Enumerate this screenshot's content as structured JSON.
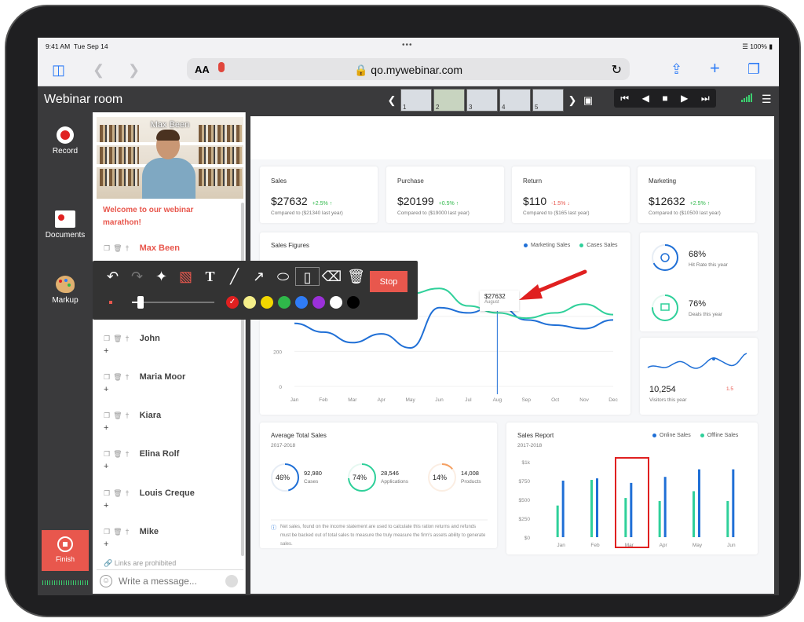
{
  "status": {
    "time": "9:41 AM",
    "date": "Tue Sep 14",
    "battery": "100%"
  },
  "browser": {
    "aa": "AA",
    "url": "qo.mywebinar.com"
  },
  "app": {
    "title": "Webinar room",
    "thumbnails": [
      "1",
      "2",
      "3",
      "4",
      "5"
    ]
  },
  "sidebar": {
    "record": "Record",
    "documents": "Documents",
    "markup": "Markup",
    "finish": "Finish"
  },
  "chat": {
    "presenter_name": "Max Been",
    "welcome": "Welcome to our webinar marathon!",
    "first_sender": "Max Been",
    "users": [
      "John",
      "Maria Moor",
      "Kiara",
      "Elina Rolf",
      "Louis Creque",
      "Mike"
    ],
    "plus": "+",
    "links_notice": "Links are prohibited",
    "placeholder": "Write a message..."
  },
  "markup_toolbar": {
    "tools": [
      "undo-icon",
      "redo-icon",
      "pointer-icon",
      "highlighter-icon",
      "text-icon",
      "line-icon",
      "arrow-icon",
      "ellipse-icon",
      "rectangle-icon",
      "eraser-icon",
      "trash-icon"
    ],
    "stop": "Stop",
    "colors": [
      "#e02020",
      "#f5ef8a",
      "#f2d600",
      "#2fb84a",
      "#2f7cf6",
      "#9b30d9",
      "#ffffff",
      "#000000"
    ],
    "selected_color": "#e02020",
    "brush_size": 0.1
  },
  "dashboard": {
    "stats": [
      {
        "title": "Sales",
        "value": "$27632",
        "delta": "+2.5%",
        "up": true,
        "compare": "Compared to ($21340 last year)"
      },
      {
        "title": "Purchase",
        "value": "$20199",
        "delta": "+0.5%",
        "up": true,
        "compare": "Compared to ($19000 last year)"
      },
      {
        "title": "Return",
        "value": "$110",
        "delta": "-1.5%",
        "up": false,
        "compare": "Compared to ($165 last year)"
      },
      {
        "title": "Marketing",
        "value": "$12632",
        "delta": "+2.5%",
        "up": true,
        "compare": "Compared to ($10500 last year)"
      }
    ],
    "sales_figures": {
      "title": "Sales Figures",
      "tooltip_value": "$27632",
      "tooltip_label": "August"
    },
    "hit_rate": {
      "value": "68%",
      "label": "Hit Rate this year"
    },
    "deals": {
      "value": "76%",
      "label": "Deals this year"
    },
    "visitors": {
      "value": "10,254",
      "label": "Visitors this year",
      "delta": "1.5"
    },
    "avg_total": {
      "title": "Average Total Sales",
      "range": "2017-2018",
      "items": [
        {
          "pct": "46%",
          "value": "92,980",
          "label": "Cases"
        },
        {
          "pct": "74%",
          "value": "28,546",
          "label": "Applications"
        },
        {
          "pct": "14%",
          "value": "14,008",
          "label": "Products"
        }
      ],
      "note": "Net sales, found on the income statement are used to calculate this ration returns and refunds must be backed out of total sales to measure the truly measure the firm's assets ability to generate sales."
    },
    "sales_report": {
      "title": "Sales Report",
      "range": "2017-2018"
    }
  },
  "chart_data": [
    {
      "type": "line",
      "title": "Sales Figures",
      "categories": [
        "Jan",
        "Feb",
        "Mar",
        "Apr",
        "May",
        "Jun",
        "Jul",
        "Aug",
        "Sep",
        "Oct",
        "Nov",
        "Dec"
      ],
      "series": [
        {
          "name": "Marketing Sales",
          "color": "#1f6fd6",
          "values": [
            360,
            310,
            250,
            300,
            220,
            450,
            420,
            470,
            380,
            350,
            330,
            380
          ]
        },
        {
          "name": "Cases Sales",
          "color": "#2fd09a",
          "values": [
            450,
            520,
            440,
            480,
            530,
            560,
            460,
            420,
            390,
            420,
            470,
            410
          ]
        }
      ],
      "yticks": [
        0,
        200,
        400
      ],
      "ylim": [
        0,
        700
      ]
    },
    {
      "type": "bar",
      "title": "Sales Report",
      "categories": [
        "Jan",
        "Feb",
        "Mar",
        "Apr",
        "May",
        "Jun"
      ],
      "series": [
        {
          "name": "Online Sales",
          "color": "#1f6fd6",
          "values": [
            750,
            780,
            720,
            800,
            900,
            900
          ]
        },
        {
          "name": "Offline Sales",
          "color": "#2fd09a",
          "values": [
            420,
            760,
            520,
            480,
            610,
            480
          ]
        }
      ],
      "yticks": [
        "$0",
        "$250",
        "$500",
        "$750",
        "$1k"
      ],
      "ylim": [
        0,
        1000
      ],
      "highlighted": "Mar"
    }
  ]
}
